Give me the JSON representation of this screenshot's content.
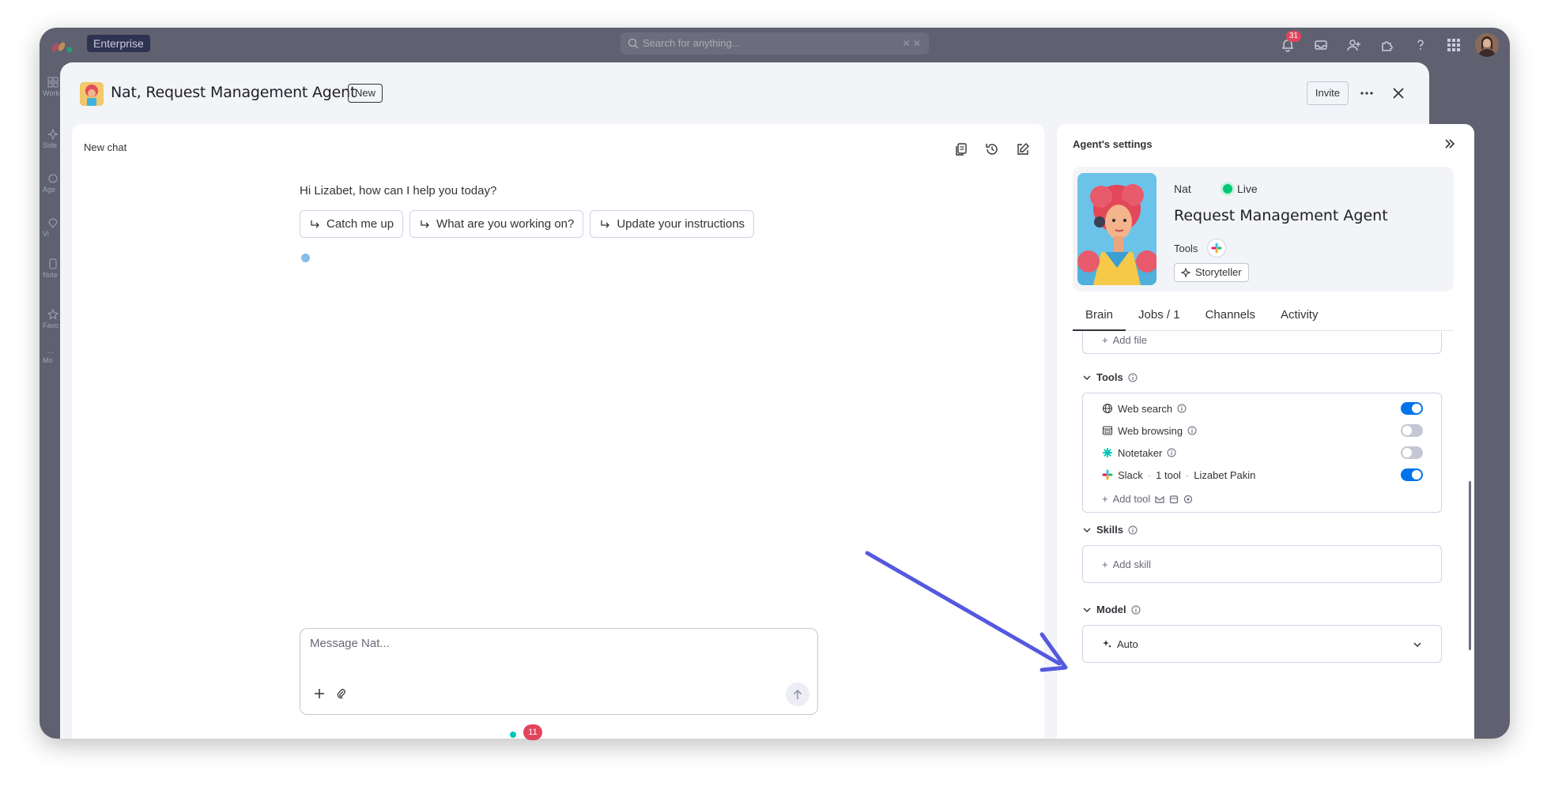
{
  "topbar": {
    "plan": "Enterprise",
    "search_placeholder": "Search for anything...",
    "notifications_count": "31"
  },
  "left_rail": {
    "items": [
      "Works",
      "Side",
      "Age",
      "Vi",
      "Note",
      "Favo",
      "Mo"
    ]
  },
  "modal": {
    "title": "Nat, Request Management Agent",
    "badge": "New",
    "invite_label": "Invite"
  },
  "chat": {
    "header": "New chat",
    "greeting": "Hi Lizabet, how can I help you today?",
    "suggestions": [
      "Catch me up",
      "What are you working on?",
      "Update your instructions"
    ],
    "composer_placeholder": "Message Nat...",
    "floating_badge": "11"
  },
  "settings": {
    "title": "Agent's settings",
    "agent_short_name": "Nat",
    "status": "Live",
    "agent_full_name": "Request Management Agent",
    "tools_label": "Tools",
    "persona": "Storyteller",
    "tabs": [
      "Brain",
      "Jobs / 1",
      "Channels",
      "Activity"
    ],
    "active_tab": "Brain",
    "knowledge": {
      "add_file": "Add file"
    },
    "tools_section": {
      "heading": "Tools",
      "items": [
        {
          "name": "Web search",
          "enabled": true,
          "icon": "globe-icon"
        },
        {
          "name": "Web browsing",
          "enabled": false,
          "icon": "browser-icon"
        },
        {
          "name": "Notetaker",
          "enabled": false,
          "icon": "notetaker-icon"
        },
        {
          "name": "Slack",
          "enabled": true,
          "icon": "slack-icon",
          "detail_count": "1 tool",
          "detail_user": "Lizabet Pakin"
        }
      ],
      "add_tool": "Add tool"
    },
    "skills_section": {
      "heading": "Skills",
      "add_skill": "Add skill"
    },
    "model_section": {
      "heading": "Model",
      "selected": "Auto"
    }
  },
  "colors": {
    "accent": "#0073ea",
    "live": "#00c875",
    "annotation_arrow": "#5559df",
    "badge_red": "#e2445c"
  }
}
